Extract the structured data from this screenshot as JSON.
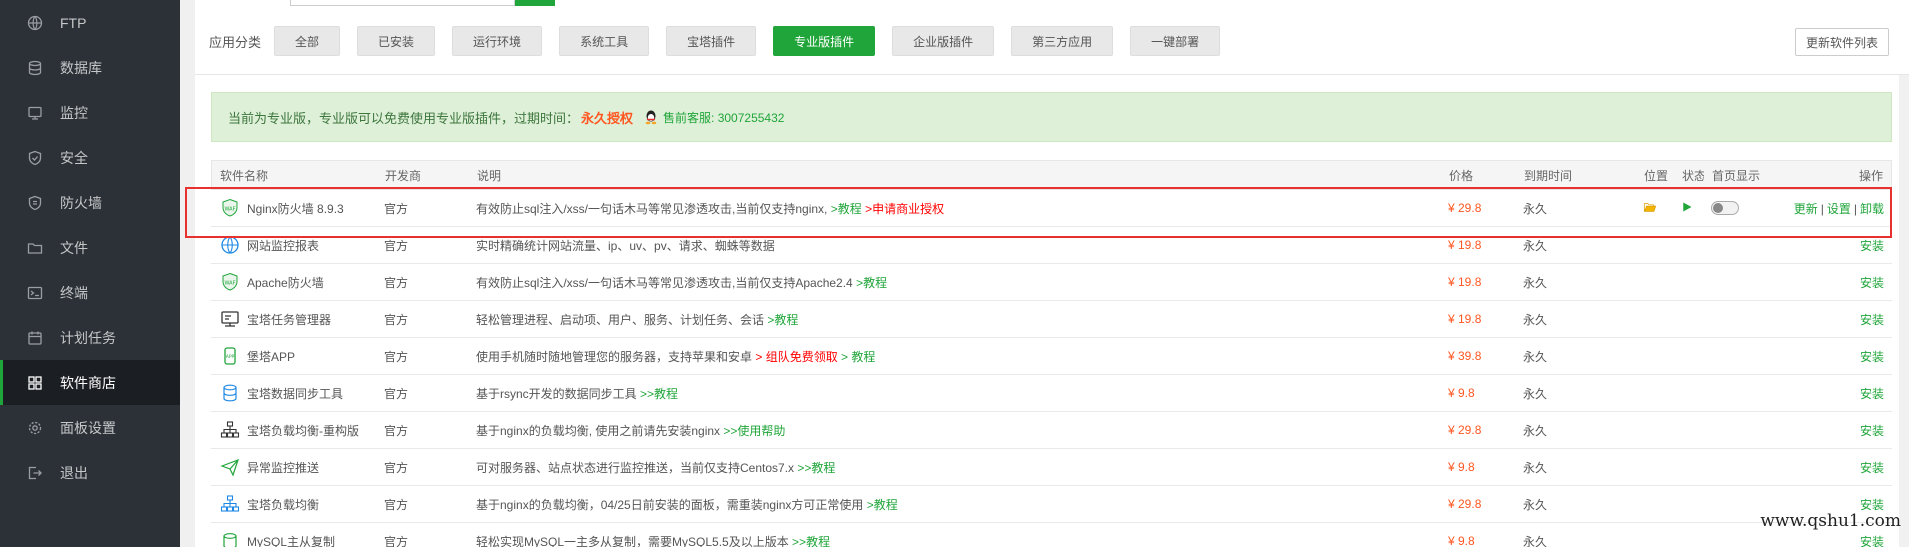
{
  "sidebar": {
    "items": [
      {
        "label": "FTP",
        "icon": "globe-icon"
      },
      {
        "label": "数据库",
        "icon": "database-icon"
      },
      {
        "label": "监控",
        "icon": "monitor-icon"
      },
      {
        "label": "安全",
        "icon": "shield-icon"
      },
      {
        "label": "防火墙",
        "icon": "firewall-icon"
      },
      {
        "label": "文件",
        "icon": "folder-icon"
      },
      {
        "label": "终端",
        "icon": "terminal-icon"
      },
      {
        "label": "计划任务",
        "icon": "calendar-icon"
      },
      {
        "label": "软件商店",
        "icon": "grid-icon",
        "active": true
      },
      {
        "label": "面板设置",
        "icon": "gear-icon"
      },
      {
        "label": "退出",
        "icon": "logout-icon"
      }
    ]
  },
  "categories": {
    "label": "应用分类",
    "items": [
      "全部",
      "已安装",
      "运行环境",
      "系统工具",
      "宝塔插件",
      "专业版插件",
      "企业版插件",
      "第三方应用",
      "一键部署"
    ],
    "active": "专业版插件"
  },
  "refresh_label": "更新软件列表",
  "notice": {
    "text": "当前为专业版，专业版可以免费使用专业版插件，过期时间：",
    "permanent": "永久授权",
    "service": "售前客服: 3007255432"
  },
  "table": {
    "headers": {
      "name": "软件名称",
      "dev": "开发商",
      "desc": "说明",
      "price": "价格",
      "expire": "到期时间",
      "position": "位置",
      "status": "状态",
      "home": "首页显示",
      "op": "操作"
    },
    "rows": [
      {
        "name": "Nginx防火墙 8.9.3",
        "dev": "官方",
        "desc": "有效防止sql注入/xss/一句话木马等常见渗透攻击,当前仅支持nginx,",
        "link1": ">教程",
        "link2": ">申请商业授权",
        "price": "¥ 29.8",
        "expire": "永久",
        "op_update": "更新",
        "op_settings": "设置",
        "op_uninstall": "卸载",
        "icon": "waf-icon"
      },
      {
        "name": "网站监控报表",
        "dev": "官方",
        "desc": "实时精确统计网站流量、ip、uv、pv、请求、蜘蛛等数据",
        "link1": "",
        "price": "¥ 19.8",
        "expire": "永久",
        "op": "安装",
        "icon": "globe-icon"
      },
      {
        "name": "Apache防火墙",
        "dev": "官方",
        "desc": "有效防止sql注入/xss/一句话木马等常见渗透攻击,当前仅支持Apache2.4",
        "link1": ">教程",
        "price": "¥ 19.8",
        "expire": "永久",
        "op": "安装",
        "icon": "waf-icon"
      },
      {
        "name": "宝塔任务管理器",
        "dev": "官方",
        "desc": "轻松管理进程、启动项、用户、服务、计划任务、会话",
        "link1": ">教程",
        "price": "¥ 19.8",
        "expire": "永久",
        "op": "安装",
        "icon": "monitor-icon"
      },
      {
        "name": "堡塔APP",
        "dev": "官方",
        "desc": "使用手机随时随地管理您的服务器，支持苹果和安卓",
        "link_red": "> 组队免费领取",
        "link1": "> 教程",
        "price": "¥ 39.8",
        "expire": "永久",
        "op": "安装",
        "icon": "app-icon"
      },
      {
        "name": "宝塔数据同步工具",
        "dev": "官方",
        "desc": "基于rsync开发的数据同步工具",
        "link1": ">>教程",
        "price": "¥ 9.8",
        "expire": "永久",
        "op": "安装",
        "icon": "database-icon"
      },
      {
        "name": "宝塔负载均衡-重构版",
        "dev": "官方",
        "desc": "基于nginx的负载均衡, 使用之前请先安装nginx",
        "link1": ">>使用帮助",
        "price": "¥ 29.8",
        "expire": "永久",
        "op": "安装",
        "icon": "network-icon"
      },
      {
        "name": "异常监控推送",
        "dev": "官方",
        "desc": "可对服务器、站点状态进行监控推送，当前仅支持Centos7.x",
        "link1": ">>教程",
        "price": "¥ 9.8",
        "expire": "永久",
        "op": "安装",
        "icon": "send-icon"
      },
      {
        "name": "宝塔负载均衡",
        "dev": "官方",
        "desc": "基于nginx的负载均衡，04/25日前安装的面板，需重装nginx方可正常使用",
        "link1": ">教程",
        "price": "¥ 29.8",
        "expire": "永久",
        "op": "安装",
        "icon": "network-icon"
      },
      {
        "name": "MySQL主从复制",
        "dev": "官方",
        "desc": "轻松实现MySQL一主多从复制，需要MySQL5.5及以上版本",
        "link1": ">>教程",
        "price": "¥ 9.8",
        "expire": "永久",
        "op": "安装",
        "icon": "mysql-icon"
      }
    ]
  },
  "watermark": "www.qshu1.com",
  "colors": {
    "accent": "#20a53a",
    "price": "#ff5722",
    "highlight": "#e8312f"
  }
}
